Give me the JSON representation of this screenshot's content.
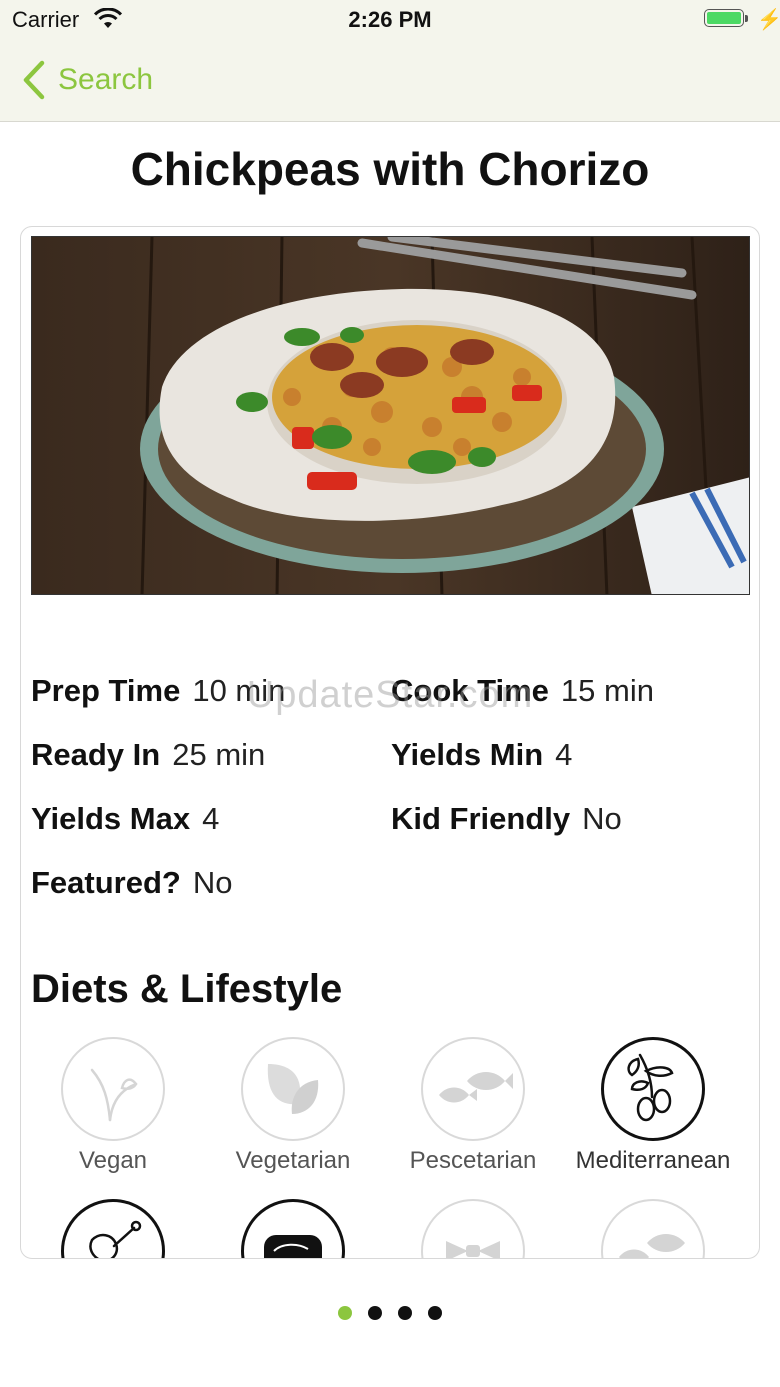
{
  "status": {
    "carrier": "Carrier",
    "time": "2:26 PM",
    "battery_color": "#4cd964"
  },
  "nav": {
    "back_label": "Search",
    "accent": "#8cc63f"
  },
  "recipe": {
    "title": "Chickpeas with Chorizo",
    "image": "photo of chickpeas with chorizo on a white plate, forks and napkin on wooden table"
  },
  "watermark": "UpdateStar.com",
  "facts": {
    "prep_time": {
      "label": "Prep Time",
      "value": "10 min"
    },
    "cook_time": {
      "label": "Cook Time",
      "value": "15 min"
    },
    "ready_in": {
      "label": "Ready In",
      "value": "25 min"
    },
    "yields_min": {
      "label": "Yields Min",
      "value": "4"
    },
    "yields_max": {
      "label": "Yields Max",
      "value": "4"
    },
    "kid_friendly": {
      "label": "Kid Friendly",
      "value": "No"
    },
    "featured": {
      "label": "Featured?",
      "value": "No"
    }
  },
  "diets": {
    "title": "Diets & Lifestyle",
    "items": [
      {
        "label": "Vegan",
        "icon": "sprout-icon",
        "active": false
      },
      {
        "label": "Vegetarian",
        "icon": "leaves-icon",
        "active": false
      },
      {
        "label": "Pescetarian",
        "icon": "fish-icon",
        "active": false
      },
      {
        "label": "Mediterranean",
        "icon": "olive-branch-icon",
        "active": true
      },
      {
        "label": "",
        "icon": "chicken-leg-icon",
        "active": true
      },
      {
        "label": "",
        "icon": "steak-icon",
        "active": true
      },
      {
        "label": "",
        "icon": "pasta-icon",
        "active": false
      },
      {
        "label": "",
        "icon": "fish-icon",
        "active": false
      }
    ]
  },
  "pager": {
    "count": 4,
    "current": 1
  }
}
